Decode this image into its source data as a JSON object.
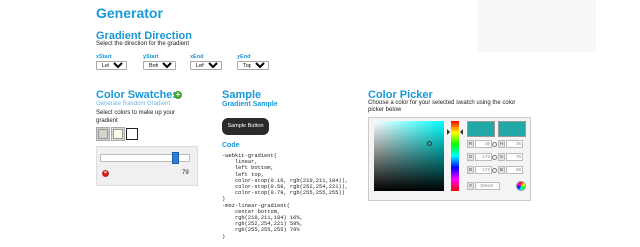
{
  "page_title": "Generator",
  "gradient_direction": {
    "heading": "Gradient Direction",
    "subtitle": "Select the direction for the gradient",
    "selects": [
      {
        "label": "xStart",
        "value": "Left"
      },
      {
        "label": "yStart",
        "value": "Bottom"
      },
      {
        "label": "xEnd",
        "value": "Left"
      },
      {
        "label": "yEnd",
        "value": "Top"
      }
    ]
  },
  "color_swatches": {
    "heading": "Color Swatches",
    "random_link": "Generate Random Gradient",
    "subtitle": "Select colors to make up your gradient",
    "swatches": [
      "#d5d3c9",
      "#fcfce9",
      "#ffffff"
    ],
    "stop_value": "79",
    "stop_fraction": 0.79
  },
  "sample": {
    "heading": "Sample",
    "subheading": "Gradient Sample",
    "button_label": "Sample Button",
    "code_heading": "Code",
    "code": "-webkit-gradient(\n    linear,\n    left bottom,\n    left top,\n    color-stop(0.16, rgb(210,211,184)),\n    color-stop(0.58, rgb(252,254,221)),\n    color-stop(0.79, rgb(255,255,255))\n)\n-moz-linear-gradient(\n    center bottom,\n    rgb(210,211,184) 16%,\n    rgb(252,254,221) 58%,\n    rgb(255,255,255) 79%\n)"
  },
  "color_picker": {
    "heading": "Color Picker",
    "subtitle": "Choose a color for your selected swatch using the color picker below",
    "fields": [
      {
        "label": "R",
        "value": "36"
      },
      {
        "label": "H",
        "value": "36"
      },
      {
        "label": "G",
        "value": "173"
      },
      {
        "label": "S",
        "value": "79"
      },
      {
        "label": "B",
        "value": "172"
      },
      {
        "label": "B",
        "value": "68"
      }
    ],
    "hex_label": "#",
    "hex_value": "Detect",
    "preview_color": "#22a8a6"
  }
}
